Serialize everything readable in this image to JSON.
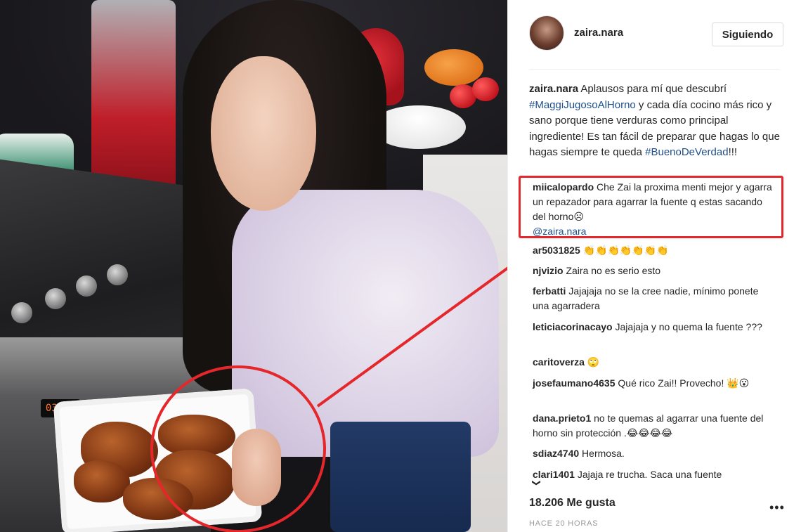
{
  "post": {
    "username": "zaira.nara",
    "follow_label": "Siguiendo",
    "caption": {
      "username": "zaira.nara",
      "part1": " Aplausos para mí que descubrí ",
      "hashtag1": "#MaggiJugosoAlHorno",
      "part2": " y cada día cocino más rico y sano porque tiene verduras como principal ingrediente! Es tan fácil de preparar que hagas lo que hagas siempre te queda ",
      "hashtag2": "#BuenoDeVerdad",
      "part3": "!!!"
    },
    "comments": [
      {
        "user": "miicalopardo",
        "text": " Che Zai la proxima menti mejor y agarra un repazador para agarrar la fuente q estas sacando del horno☹",
        "mention": "@zaira.nara"
      },
      {
        "user": "ar5031825",
        "text": " 👏👏👏👏👏👏👏"
      },
      {
        "user": "njvizio",
        "text": " Zaira no es serio esto"
      },
      {
        "user": "ferbatti",
        "text": " Jajajaja no se la cree nadie, mínimo ponete una agarradera"
      },
      {
        "user": "leticiacorinacayo",
        "text": " Jajajaja y no quema la fuente ???"
      },
      {
        "user": "caritoverza",
        "text": " 🙄"
      },
      {
        "user": "josefaumano4635",
        "text": " Qué rico Zai!! Provecho! 👑😮"
      },
      {
        "user": "dana.prieto1",
        "text": " no te quemas al agarrar una fuente del horno sin protección .😂😂😂😂"
      },
      {
        "user": "sdiaz4740",
        "text": " Hermosa."
      },
      {
        "user": "clari1401",
        "text": " Jajaja re trucha. Saca una fuente"
      }
    ],
    "load_more_icon": "❯",
    "likes": "18.206 Me gusta",
    "more_icon": "•••",
    "time": "HACE 20 HORAS"
  },
  "photo": {
    "oven_clock": "03:46"
  },
  "colors": {
    "annotation_red": "#e5262a",
    "hashtag_blue": "#1f4f8b"
  }
}
